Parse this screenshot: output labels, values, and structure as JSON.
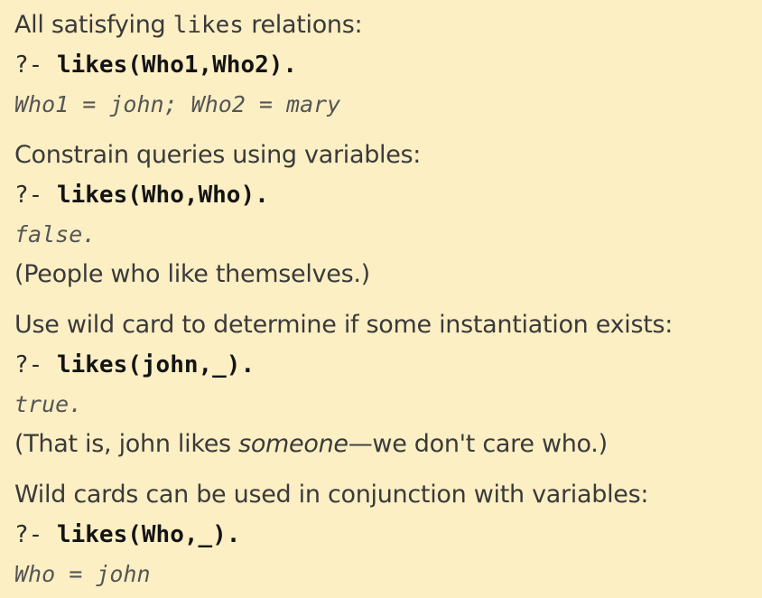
{
  "sections": [
    {
      "heading_pre": "All satisfying ",
      "heading_code": "likes",
      "heading_post": " relations:",
      "prompt": "?- ",
      "query": "likes(Who1,Who2).",
      "answer": "Who1 = john; Who2 = mary"
    },
    {
      "heading": "Constrain queries using variables:",
      "prompt": "?- ",
      "query": "likes(Who,Who).",
      "answer": "false.",
      "note": "(People who like themselves.)"
    },
    {
      "heading": "Use wild card to determine if some instantiation exists:",
      "prompt": "?- ",
      "query": "likes(john,_).",
      "answer": "true.",
      "note_pre": "(That is, john likes ",
      "note_em": "someone",
      "note_post": "—we don't care who.)"
    },
    {
      "heading": "Wild cards can be used in conjunction with variables:",
      "prompt": "?- ",
      "query": "likes(Who,_).",
      "answer": "Who = john"
    }
  ]
}
